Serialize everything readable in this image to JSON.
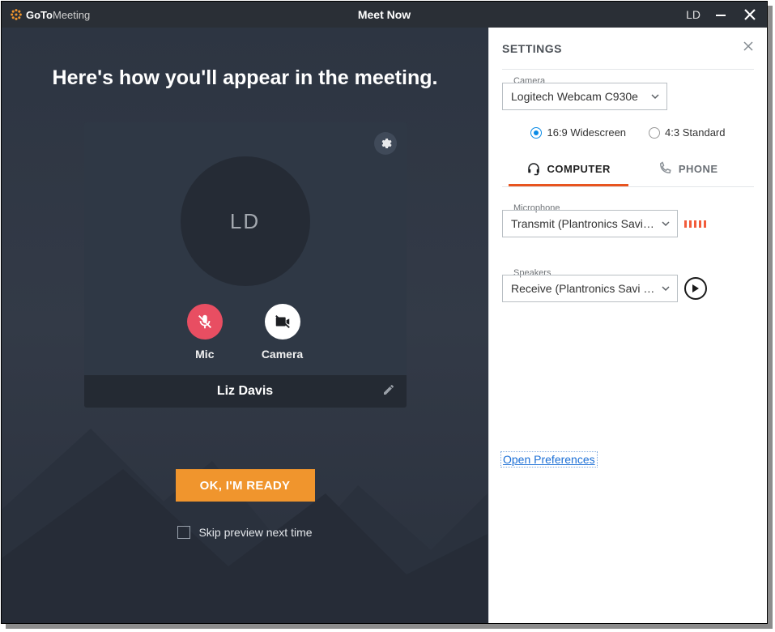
{
  "titlebar": {
    "brand_bold": "GoTo",
    "brand_light": "Meeting",
    "center": "Meet Now",
    "user_initials": "LD"
  },
  "preview": {
    "heading": "Here's how you'll appear in the meeting.",
    "avatar_initials": "LD",
    "mic_label": "Mic",
    "camera_label": "Camera",
    "display_name": "Liz Davis",
    "ready_button": "OK, I'M READY",
    "skip_label": "Skip preview next time"
  },
  "settings": {
    "title": "SETTINGS",
    "camera": {
      "label": "Camera",
      "value": "Logitech Webcam C930e"
    },
    "aspect": {
      "wide_label": "16:9 Widescreen",
      "standard_label": "4:3 Standard",
      "selected": "wide"
    },
    "tabs": {
      "computer": "COMPUTER",
      "phone": "PHONE"
    },
    "microphone": {
      "label": "Microphone",
      "value": "Transmit (Plantronics Savi…"
    },
    "speakers": {
      "label": "Speakers",
      "value": "Receive (Plantronics Savi …"
    },
    "open_preferences": "Open Preferences"
  }
}
